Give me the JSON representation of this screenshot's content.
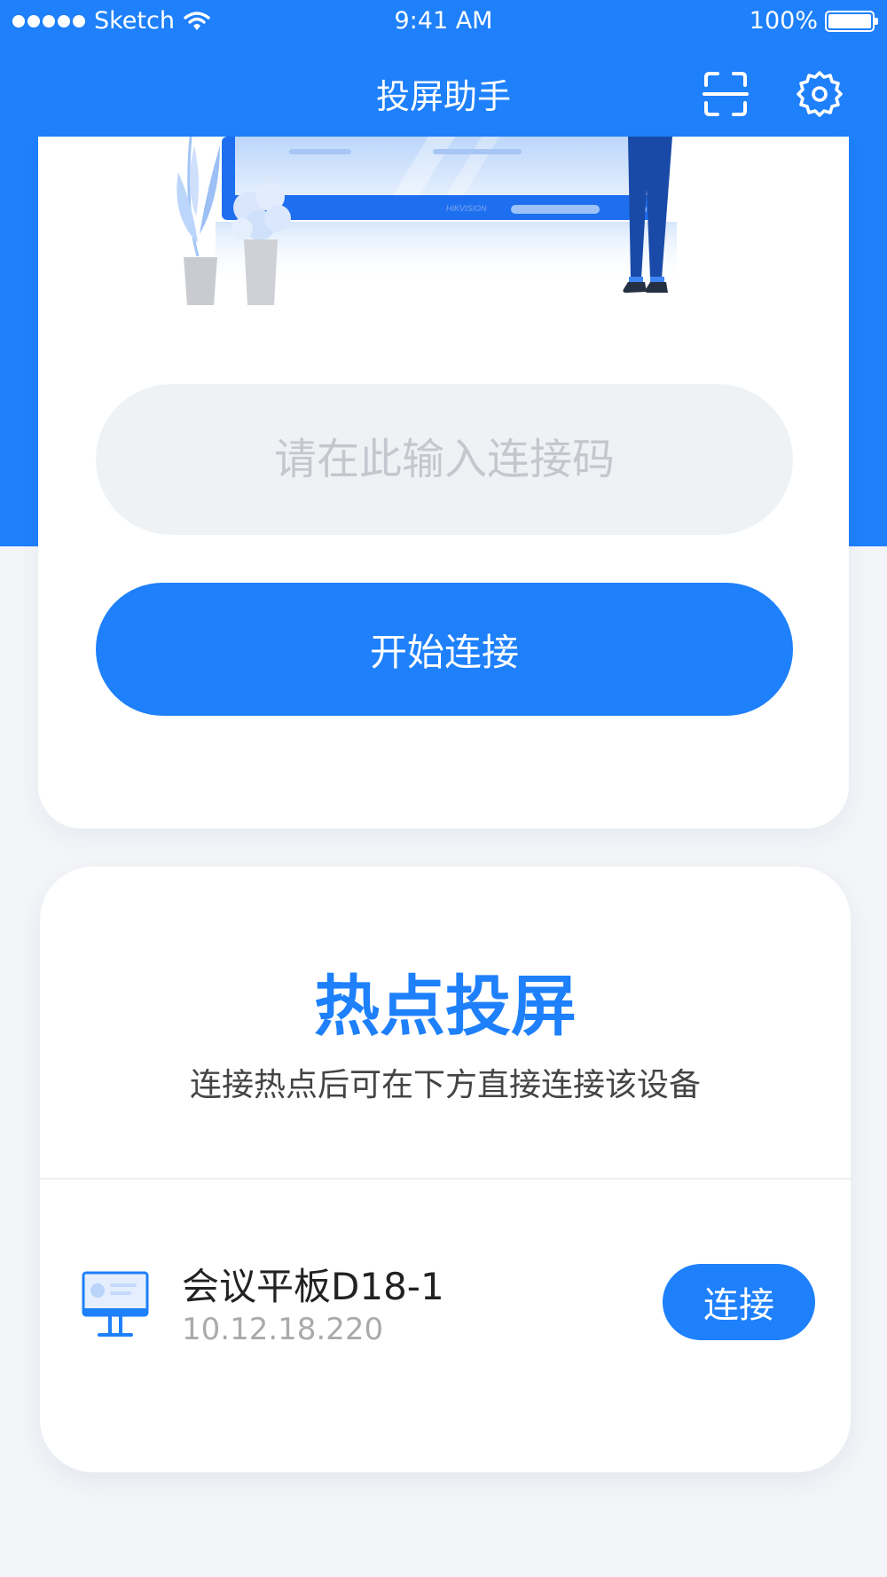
{
  "status_bar": {
    "carrier": "Sketch",
    "time": "9:41 AM",
    "battery": "100%"
  },
  "nav": {
    "title": "投屏助手",
    "icons": [
      "scan-icon",
      "gear-icon"
    ]
  },
  "connect_card": {
    "input_placeholder": "请在此输入连接码",
    "input_value": "",
    "button_label": "开始连接",
    "illustration_brand": "HIKVISION"
  },
  "hotspot_card": {
    "title": "热点投屏",
    "subtitle": "连接热点后可在下方直接连接该设备",
    "devices": [
      {
        "name": "会议平板D18-1",
        "ip": "10.12.18.220",
        "button_label": "连接",
        "icon": "monitor-icon"
      }
    ]
  },
  "colors": {
    "primary": "#1e80fb",
    "background": "#f3f5f8",
    "input_bg": "#eff2f5",
    "placeholder": "#c4c8ce"
  }
}
